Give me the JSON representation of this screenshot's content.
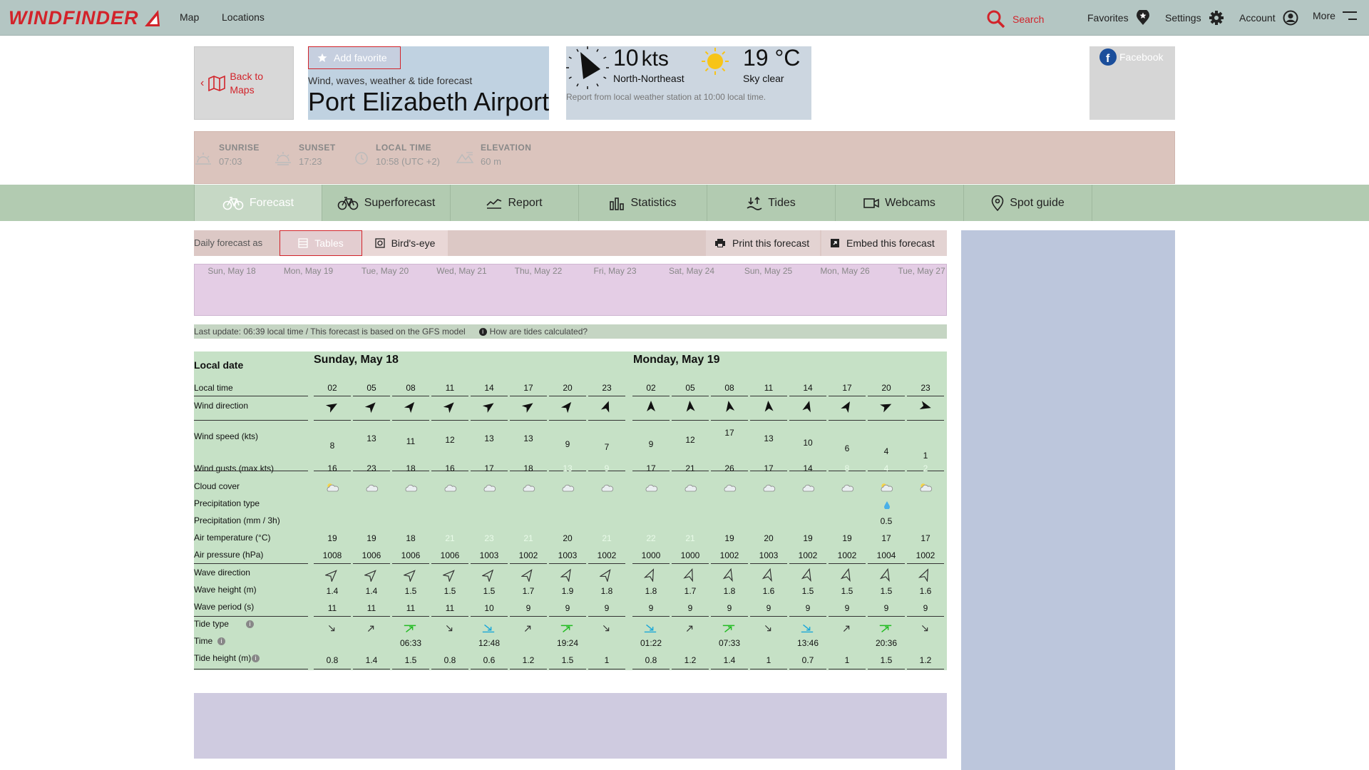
{
  "nav": {
    "logo": "WINDFINDER",
    "links": [
      "Map",
      "Locations"
    ],
    "search": "Search",
    "favorites": "Favorites",
    "settings": "Settings",
    "account": "Account",
    "more": "More"
  },
  "header": {
    "back_label": "Back to Maps",
    "add_favorite": "Add favorite",
    "subtitle": "Wind, waves, weather & tide forecast",
    "title": "Port Elizabeth Airport",
    "facebook": "Facebook"
  },
  "weather": {
    "speed": "10",
    "speed_unit": "kts",
    "direction": "North-Northeast",
    "temp": "19 °C",
    "sky": "Sky clear",
    "note": "Report from local weather station at 10:00 local time.",
    "wind_from_deg": 22
  },
  "facts": {
    "sunrise_label": "SUNRISE",
    "sunrise": "07:03",
    "sunset_label": "SUNSET",
    "sunset": "17:23",
    "localtime_label": "LOCAL TIME",
    "localtime": "10:58 (UTC +2)",
    "elevation_label": "ELEVATION",
    "elevation": "60 m"
  },
  "tabs": [
    "Forecast",
    "Superforecast",
    "Report",
    "Statistics",
    "Tides",
    "Webcams",
    "Spot guide"
  ],
  "toolbar": {
    "label": "Daily forecast as",
    "tables": "Tables",
    "birdseye": "Bird's-eye",
    "print": "Print this forecast",
    "embed": "Embed this forecast"
  },
  "days_strip": [
    "Sun, May 18",
    "Mon, May 19",
    "Tue, May 20",
    "Wed, May 21",
    "Thu, May 22",
    "Fri, May 23",
    "Sat, May 24",
    "Sun, May 25",
    "Mon, May 26",
    "Tue, May 27"
  ],
  "update": {
    "text": "Last update: 06:39 local time / This forecast is based on the GFS model",
    "tides_link": "How are tides calculated?"
  },
  "table": {
    "row_labels": {
      "local_date": "Local date",
      "local_time": "Local time",
      "wind_dir": "Wind direction",
      "wind_speed": "Wind speed (kts)",
      "gusts": "Wind gusts (max kts)",
      "cloud": "Cloud cover",
      "precip_type": "Precipitation type",
      "precip": "Precipitation (mm / 3h)",
      "air_temp": "Air temperature (°C)",
      "pressure": "Air pressure (hPa)",
      "wave_dir": "Wave direction",
      "wave_h": "Wave height (m)",
      "wave_p": "Wave period (s)",
      "tide_type": "Tide type",
      "tide_time": "Time",
      "tide_h": "Tide height (m)"
    },
    "days": [
      {
        "date": "Sunday, May 18",
        "hours": [
          "02",
          "05",
          "08",
          "11",
          "14",
          "17",
          "20",
          "23"
        ],
        "wind_dir_deg": [
          60,
          45,
          40,
          45,
          55,
          55,
          40,
          20
        ],
        "wind_speed": [
          8,
          13,
          11,
          12,
          13,
          13,
          9,
          7
        ],
        "gusts": [
          "16",
          "23",
          "18",
          "16",
          "17",
          "18",
          "13",
          "9"
        ],
        "gust_light": [
          false,
          false,
          false,
          false,
          false,
          false,
          true,
          true
        ],
        "cloud": [
          "partly",
          "cloudy",
          "cloudy",
          "cloudy",
          "cloudy",
          "cloudy",
          "cloudy",
          "cloudy"
        ],
        "precip": [
          "",
          "",
          "",
          "",
          "",
          "",
          "",
          ""
        ],
        "air_temp": [
          "19",
          "19",
          "18",
          "21",
          "23",
          "21",
          "20",
          "21"
        ],
        "temp_light": [
          false,
          false,
          false,
          true,
          true,
          true,
          false,
          true
        ],
        "pressure": [
          "1008",
          "1006",
          "1006",
          "1006",
          "1003",
          "1002",
          "1003",
          "1002"
        ],
        "wave_dir_deg": [
          45,
          45,
          45,
          45,
          40,
          35,
          30,
          35
        ],
        "wave_h": [
          "1.4",
          "1.4",
          "1.5",
          "1.5",
          "1.5",
          "1.7",
          "1.9",
          "1.8"
        ],
        "wave_p": [
          "11",
          "11",
          "11",
          "11",
          "10",
          "9",
          "9",
          "9"
        ],
        "tide_type": [
          "falling",
          "rising",
          "high",
          "falling",
          "low",
          "rising",
          "high",
          "falling"
        ],
        "tide_time": [
          "",
          "",
          "06:33",
          "",
          "12:48",
          "",
          "19:24",
          ""
        ],
        "tide_h": [
          "0.8",
          "1.4",
          "1.5",
          "0.8",
          "0.6",
          "1.2",
          "1.5",
          "1"
        ]
      },
      {
        "date": "Monday, May 19",
        "hours": [
          "02",
          "05",
          "08",
          "11",
          "14",
          "17",
          "20",
          "23"
        ],
        "wind_dir_deg": [
          0,
          355,
          350,
          355,
          15,
          30,
          65,
          105
        ],
        "wind_speed": [
          9,
          12,
          17,
          13,
          10,
          6,
          4,
          1
        ],
        "gusts": [
          "17",
          "21",
          "26",
          "17",
          "14",
          "8",
          "4",
          "2"
        ],
        "gust_light": [
          false,
          false,
          false,
          false,
          false,
          true,
          true,
          true
        ],
        "cloud": [
          "cloudy",
          "cloudy",
          "cloudy",
          "cloudy",
          "cloudy",
          "cloudy",
          "partly",
          "partly"
        ],
        "precip": [
          "",
          "",
          "",
          "",
          "",
          "",
          "0.5",
          ""
        ],
        "air_temp": [
          "22",
          "21",
          "19",
          "20",
          "19",
          "19",
          "17",
          "17"
        ],
        "temp_light": [
          true,
          true,
          false,
          false,
          false,
          false,
          false,
          false
        ],
        "pressure": [
          "1000",
          "1000",
          "1002",
          "1003",
          "1002",
          "1002",
          "1004",
          "1002"
        ],
        "wave_dir_deg": [
          25,
          20,
          15,
          15,
          15,
          15,
          15,
          25
        ],
        "wave_h": [
          "1.8",
          "1.7",
          "1.8",
          "1.6",
          "1.5",
          "1.5",
          "1.5",
          "1.6"
        ],
        "wave_p": [
          "9",
          "9",
          "9",
          "9",
          "9",
          "9",
          "9",
          "9"
        ],
        "tide_type": [
          "low",
          "rising",
          "high",
          "falling",
          "low",
          "rising",
          "high",
          "falling"
        ],
        "tide_time": [
          "01:22",
          "",
          "07:33",
          "",
          "13:46",
          "",
          "20:36",
          ""
        ],
        "tide_h": [
          "0.8",
          "1.2",
          "1.4",
          "1",
          "0.7",
          "1",
          "1.5",
          "1.2"
        ]
      }
    ]
  },
  "colors": {
    "brand": "#d2232a",
    "navbar": "#b4c6c3",
    "tabbar": "#b2cbb1",
    "table_bg": "#c6e1c6",
    "tide_high": "#22bb22",
    "tide_low": "#1aa7d8"
  }
}
